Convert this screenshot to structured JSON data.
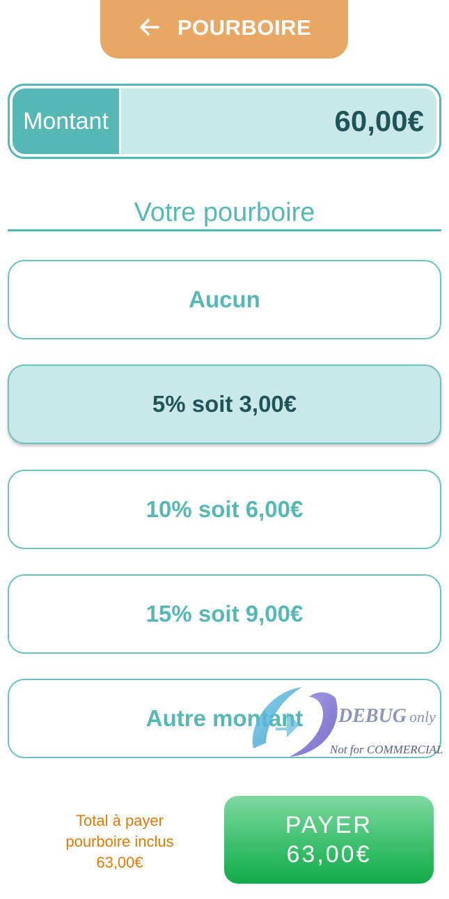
{
  "header": {
    "back_icon": "arrow-left-icon",
    "title": "POURBOIRE",
    "color": "#e8a865"
  },
  "amount": {
    "label": "Montant",
    "value": "60,00€"
  },
  "tip_section": {
    "title": "Votre pourboire"
  },
  "options": [
    {
      "label": "Aucun",
      "selected": false
    },
    {
      "label": "5% soit 3,00€",
      "selected": true
    },
    {
      "label": "10% soit 6,00€",
      "selected": false
    },
    {
      "label": "15% soit 9,00€",
      "selected": false
    },
    {
      "label": "Autre montant",
      "selected": false
    }
  ],
  "watermark": {
    "line1": "DEBUG",
    "line1_suffix": "only",
    "line2": "Not for COMMERCIAL"
  },
  "footer": {
    "total_line1": "Total à payer",
    "total_line2": "pourboire inclus",
    "total_value": "63,00€",
    "pay_label": "PAYER",
    "pay_value": "63,00€"
  },
  "colors": {
    "accent": "#56b8b5",
    "selected_bg": "#c9e9e8",
    "dark_text": "#1f5556",
    "total_text": "#de7a06",
    "pay_green": "#3ec06d"
  }
}
